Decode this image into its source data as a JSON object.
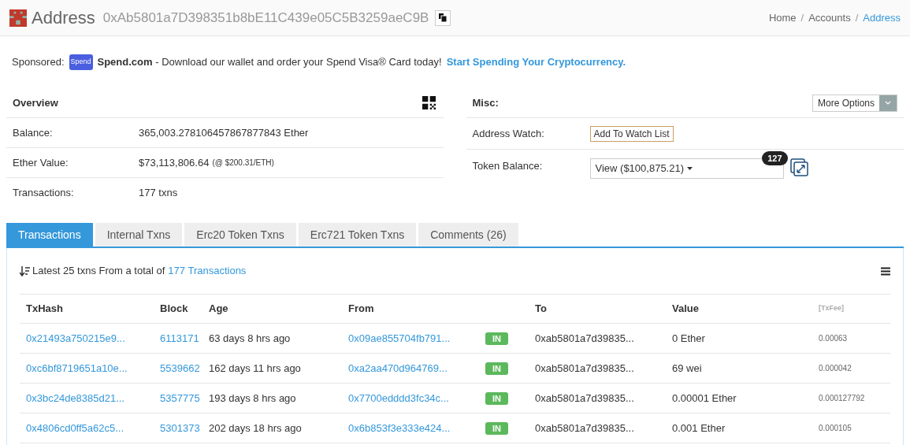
{
  "header": {
    "title": "Address",
    "address": "0xAb5801a7D398351b8bE11C439e05C5B3259aeC9B"
  },
  "breadcrumb": {
    "separator": "/",
    "items": [
      {
        "label": "Home",
        "current": false
      },
      {
        "label": "Accounts",
        "current": false
      },
      {
        "label": "Address",
        "current": true
      }
    ]
  },
  "sponsored": {
    "label": "Sponsored:",
    "logo_text": "Spend",
    "text": "**Spend.com** - Download our wallet and order your Spend Visa® Card today!",
    "link": "Start Spending Your Cryptocurrency."
  },
  "overview": {
    "title": "Overview",
    "rows": [
      {
        "label": "Balance:",
        "value": "365,003.278106457867877843 Ether"
      },
      {
        "label": "Ether Value:",
        "value": "$73,113,806.64",
        "note": "(@ $200.31/ETH)"
      },
      {
        "label": "Transactions:",
        "value": "177 txns"
      }
    ]
  },
  "misc": {
    "title": "Misc:",
    "more_options": "More Options",
    "address_watch": {
      "label": "Address Watch:",
      "button": "Add To Watch List"
    },
    "token_balance": {
      "label": "Token Balance:",
      "value": "View ($100,875.21)",
      "count": "127"
    }
  },
  "tabs": [
    {
      "label": "Transactions",
      "selected": true
    },
    {
      "label": "Internal Txns",
      "selected": false
    },
    {
      "label": "Erc20 Token Txns",
      "selected": false
    },
    {
      "label": "Erc721 Token Txns",
      "selected": false
    },
    {
      "label": "Comments (26)",
      "selected": false
    }
  ],
  "summary": {
    "text": "Latest 25 txns From a total of",
    "link": "177 Transactions"
  },
  "table": {
    "columns": [
      "TxHash",
      "Block",
      "Age",
      "From",
      "",
      "To",
      "Value",
      "[TxFee]"
    ],
    "rows": [
      {
        "hash": "0x21493a750215e9...",
        "block": "6113171",
        "age": "63 days 8 hrs ago",
        "from": "0x09ae855704fb791...",
        "direction": "IN",
        "to": "0xab5801a7d39835...",
        "value": "0 Ether",
        "fee": "0.00063"
      },
      {
        "hash": "0xc6bf8719651a10e...",
        "block": "5539662",
        "age": "162 days 11 hrs ago",
        "from": "0xa2aa470d964769...",
        "direction": "IN",
        "to": "0xab5801a7d39835...",
        "value": "69 wei",
        "fee": "0.000042"
      },
      {
        "hash": "0x3bc24de8385d21...",
        "block": "5357775",
        "age": "193 days 8 hrs ago",
        "from": "0x7700edddd3fc34c...",
        "direction": "IN",
        "to": "0xab5801a7d39835...",
        "value": "0.00001 Ether",
        "fee": "0.000127792"
      },
      {
        "hash": "0x4806cd0ff5a62c5...",
        "block": "5301373",
        "age": "202 days 18 hrs ago",
        "from": "0x6b853f3e333e424...",
        "direction": "IN",
        "to": "0xab5801a7d39835...",
        "value": "0.001 Ether",
        "fee": "0.000105"
      }
    ]
  }
}
